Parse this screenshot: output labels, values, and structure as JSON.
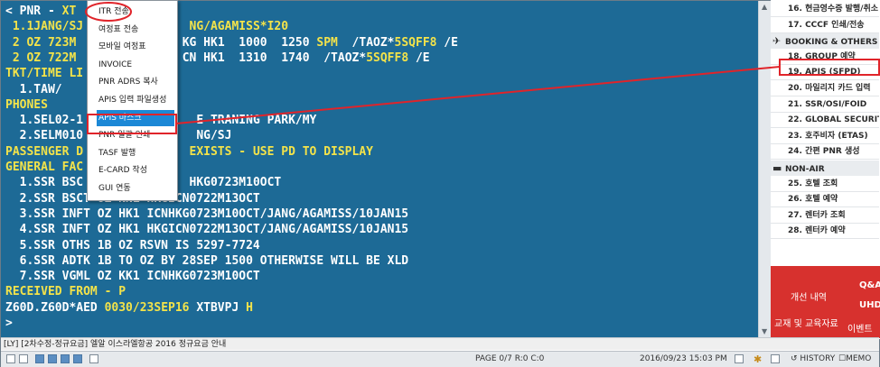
{
  "terminal": {
    "lines": [
      [
        {
          "t": "< PNR - "
        },
        {
          "t": "XT",
          "c": "y"
        }
      ],
      [
        {
          "t": " 1.1JANG/SJ",
          "c": "y"
        },
        {
          "t": "               "
        },
        {
          "t": "NG/AGAMISS*I20",
          "c": "y"
        }
      ],
      [
        {
          "t": " 2 OZ 723M",
          "c": "y"
        },
        {
          "t": "               "
        },
        {
          "t": "KG HK1  1000  1250 "
        },
        {
          "t": "SPM",
          "c": "y"
        },
        {
          "t": "  /TAOZ*"
        },
        {
          "t": "5SQFF8",
          "c": "y"
        },
        {
          "t": " /E"
        }
      ],
      [
        {
          "t": " 2 OZ 722M",
          "c": "y"
        },
        {
          "t": "               "
        },
        {
          "t": "CN HK1  1310  1740  /TAOZ*"
        },
        {
          "t": "5SQFF8",
          "c": "y"
        },
        {
          "t": " /E"
        }
      ],
      [
        {
          "t": "TKT/TIME LI",
          "c": "y"
        }
      ],
      [
        {
          "t": "  1.TAW/"
        }
      ],
      [
        {
          "t": "PHONES",
          "c": "y"
        }
      ],
      [
        {
          "t": "  1.SEL02-1"
        },
        {
          "t": "                "
        },
        {
          "t": "E TRANING PARK/MY"
        }
      ],
      [
        {
          "t": "  2.SELM010"
        },
        {
          "t": "                "
        },
        {
          "t": "NG/SJ"
        }
      ],
      [
        {
          "t": "PASSENGER D",
          "c": "y"
        },
        {
          "t": "               "
        },
        {
          "t": "EXISTS - USE PD TO DISPLAY",
          "c": "y"
        }
      ],
      [
        {
          "t": "GENERAL FAC",
          "c": "y"
        }
      ],
      [
        {
          "t": "  1.SSR BSC"
        },
        {
          "t": "               "
        },
        {
          "t": "HKG0723M10OCT"
        }
      ],
      [
        {
          "t": "  2.SSR BSCT OZ NN1 HKGICN0722M13OCT"
        }
      ],
      [
        {
          "t": "  3.SSR INFT OZ HK1 ICNHKG0723M10OCT/JANG/AGAMISS/10JAN15"
        }
      ],
      [
        {
          "t": "  4.SSR INFT OZ HK1 HKGICN0722M13OCT/JANG/AGAMISS/10JAN15"
        }
      ],
      [
        {
          "t": "  5.SSR OTHS 1B OZ RSVN IS 5297-7724"
        }
      ],
      [
        {
          "t": "  6.SSR ADTK 1B TO OZ BY 28SEP 1500 OTHERWISE WILL BE XLD"
        }
      ],
      [
        {
          "t": "  7.SSR VGML OZ KK1 ICNHKG0723M10OCT"
        }
      ],
      [
        {
          "t": "RECEIVED FROM - P",
          "c": "y"
        }
      ],
      [
        {
          "t": "Z60D.Z60D*AED "
        },
        {
          "t": "0030/23SEP16",
          "c": "y"
        },
        {
          "t": " XTBVPJ "
        },
        {
          "t": "H",
          "c": "y"
        }
      ],
      [
        {
          "t": ">"
        }
      ]
    ]
  },
  "popup": {
    "items": [
      {
        "label": "ITR 전송"
      },
      {
        "label": "여정표 전송"
      },
      {
        "label": "모바일 여정표"
      },
      {
        "label": "INVOICE"
      },
      {
        "label": "PNR ADRS 복사"
      },
      {
        "label": "APIS 입력 파일생성"
      },
      {
        "label": "APIS 마스크",
        "selected": true
      },
      {
        "label": "PNR 일괄 인쇄"
      },
      {
        "label": "TASF 발행"
      },
      {
        "label": "E-CARD 작성"
      },
      {
        "label": "GUI 연동"
      }
    ]
  },
  "side_panel": {
    "entries": [
      {
        "kind": "item",
        "label": "16. 현금영수증 발행/취소"
      },
      {
        "kind": "item",
        "label": "17. CCCF 인쇄/전송"
      },
      {
        "kind": "header",
        "label": "BOOKING & OTHERS",
        "icon": "airplane-icon"
      },
      {
        "kind": "item",
        "label": "18. GROUP 예약"
      },
      {
        "kind": "item",
        "label": "19. APIS (SFPD)",
        "highlight": true
      },
      {
        "kind": "item",
        "label": "20. 마일리지 카드 입력"
      },
      {
        "kind": "item",
        "label": "21. SSR/OSI/FOID"
      },
      {
        "kind": "item",
        "label": "22. GLOBAL SECURITY"
      },
      {
        "kind": "item",
        "label": "23. 호주비자 (ETAS)"
      },
      {
        "kind": "item",
        "label": "24. 간편 PNR 생성"
      },
      {
        "kind": "header",
        "label": "NON-AIR",
        "icon": "bus-icon"
      },
      {
        "kind": "item",
        "label": "25. 호텔 조회"
      },
      {
        "kind": "item",
        "label": "26. 호텔 예약"
      },
      {
        "kind": "item",
        "label": "27. 렌터카 조회"
      },
      {
        "kind": "item",
        "label": "28. 렌터카 예약"
      }
    ],
    "promo": {
      "improvements": "개선 내역",
      "qa": "Q&A",
      "uhd": "UHD",
      "education": "교재 및 교육자료",
      "event": "이벤트"
    }
  },
  "statusbar": {
    "notice": "[LY] [2차수정-정규요금] 엘알 이스라엘항공 2016 정규요금 안내"
  },
  "bottombar": {
    "page": "PAGE 0/7 R:0 C:0",
    "datetime": "2016/09/23 15:03 PM",
    "history": "HISTORY",
    "memo": "MEMO"
  },
  "colors": {
    "terminal_bg": "#1d6a96",
    "terminal_text": "#ffffff",
    "terminal_highlight": "#f3e34a",
    "selection": "#1c88d6",
    "annotation_red": "#e0242a",
    "promo_red": "#d7312e"
  }
}
